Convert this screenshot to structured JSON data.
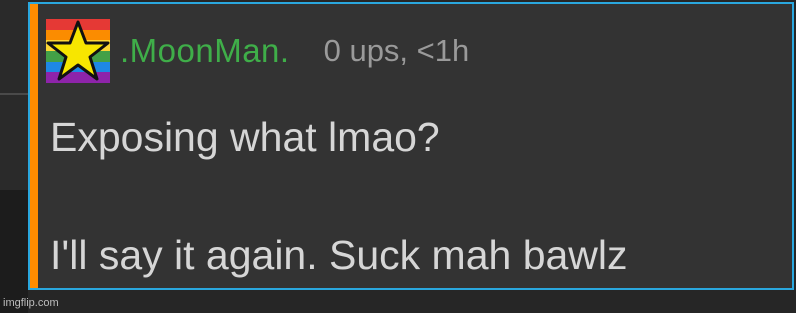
{
  "comment": {
    "username": ".MoonMan.",
    "meta": "0 ups, <1h",
    "lines": [
      "Exposing what lmao?",
      "I'll say it again. Suck mah bawlz"
    ],
    "avatar_icon": "rainbow-star-avatar"
  },
  "watermark": "imgflip.com",
  "colors": {
    "accent": "#ff8c00",
    "card_border": "#2aa7de",
    "username": "#3fae49",
    "card_bg": "#333333"
  }
}
